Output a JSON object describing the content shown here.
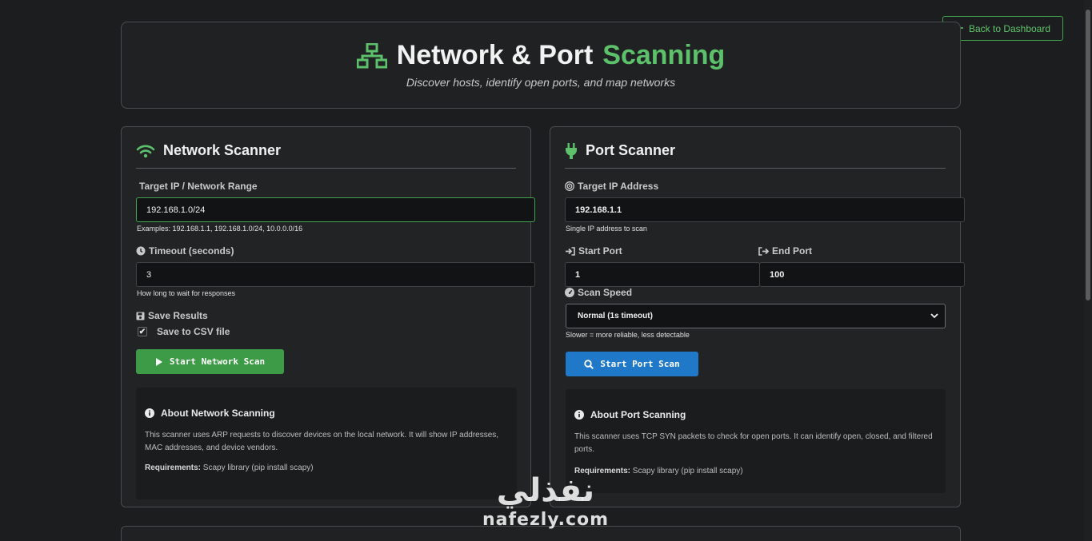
{
  "nav": {
    "back_label": "Back to Dashboard"
  },
  "header": {
    "title_main": "Network & Port",
    "title_accent": "Scanning",
    "subtitle": "Discover hosts, identify open ports, and map networks"
  },
  "network_scanner": {
    "title": "Network Scanner",
    "target_label": "Target IP / Network Range",
    "target_value": "192.168.1.0/24",
    "target_hint": "Examples: 192.168.1.1, 192.168.1.0/24, 10.0.0.0/16",
    "timeout_label": "Timeout (seconds)",
    "timeout_value": "3",
    "timeout_hint": "How long to wait for responses",
    "save_label": "Save Results",
    "save_checkbox_label": "Save to CSV file",
    "save_checked": true,
    "start_button": "Start Network Scan",
    "about_title": "About Network Scanning",
    "about_text": "This scanner uses ARP requests to discover devices on the local network. It will show IP addresses, MAC addresses, and device vendors.",
    "req_label": "Requirements:",
    "req_text": "Scapy library (pip install scapy)"
  },
  "port_scanner": {
    "title": "Port Scanner",
    "target_label": "Target IP Address",
    "target_value": "192.168.1.1",
    "target_hint": "Single IP address to scan",
    "start_port_label": "Start Port",
    "start_port_value": "1",
    "end_port_label": "End Port",
    "end_port_value": "100",
    "speed_label": "Scan Speed",
    "speed_value": "Normal (1s timeout)",
    "speed_hint": "Slower = more reliable, less detectable",
    "start_button": "Start Port Scan",
    "about_title": "About Port Scanning",
    "about_text": "This scanner uses TCP SYN packets to check for open ports. It can identify open, closed, and filtered ports.",
    "req_label": "Requirements:",
    "req_text": "Scapy library (pip install scapy)"
  },
  "watermark": {
    "arabic": "نفذلي",
    "latin": "nafezly.com"
  },
  "colors": {
    "accent_green": "#5cc16a",
    "button_green": "#3d9a46",
    "button_blue": "#1f78c8",
    "background": "#1c1d1e"
  }
}
